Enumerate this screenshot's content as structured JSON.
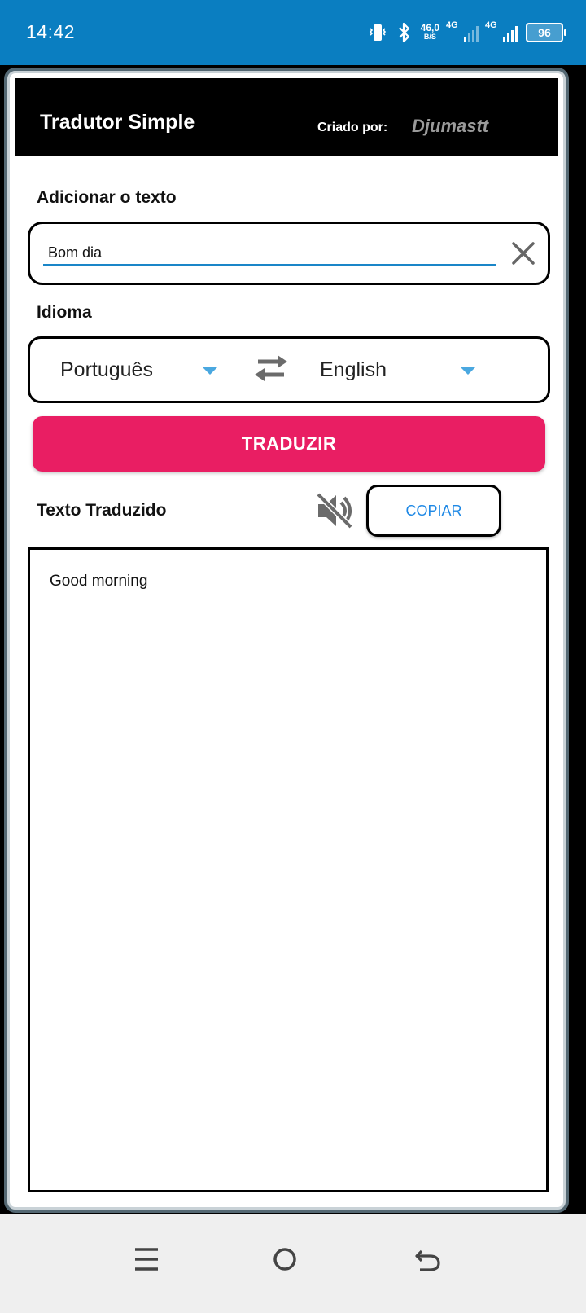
{
  "status_bar": {
    "time": "14:42",
    "net_speed": "46,0",
    "net_speed_unit": "B/S",
    "signal1_label": "4G",
    "signal2_label": "4G",
    "battery": "96",
    "icons": [
      "vibrate-icon",
      "bluetooth-icon",
      "signal-icon",
      "battery-icon"
    ]
  },
  "app": {
    "title": "Tradutor Simple",
    "created_label": "Criado por:",
    "author": "Djumastt"
  },
  "input_section": {
    "label": "Adicionar o texto",
    "value": "Bom dia",
    "placeholder": ""
  },
  "language_section": {
    "label": "Idioma",
    "source": "Português",
    "target": "English"
  },
  "translate_button": "TRADUZIR",
  "output_section": {
    "label": "Texto Traduzido",
    "copy_button": "COPIAR",
    "text": "Good morning"
  },
  "colors": {
    "status_bar": "#0A7EC1",
    "accent": "#E91E63",
    "link": "#1E88E5",
    "input_underline": "#1A86C8",
    "caret": "#4AA8E0"
  }
}
